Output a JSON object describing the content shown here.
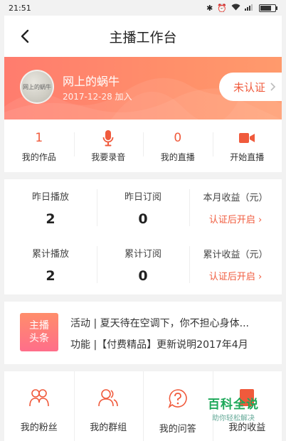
{
  "status_bar": {
    "time": "21:51",
    "icons": [
      "bluetooth-icon",
      "alarm-icon",
      "wifi-icon",
      "signal-icon",
      "battery-icon"
    ]
  },
  "nav": {
    "title": "主播工作台",
    "back_icon": "chevron-left-icon"
  },
  "profile": {
    "name": "网上的蜗牛",
    "joined": "2017-12-28 加入",
    "avatar_text": "网上的蜗牛",
    "verify_label": "未认证"
  },
  "quick_actions": [
    {
      "value": "1",
      "label": "我的作品"
    },
    {
      "icon": "microphone-icon",
      "label": "我要录音"
    },
    {
      "value": "0",
      "label": "我的直播"
    },
    {
      "icon": "video-camera-icon",
      "label": "开始直播"
    }
  ],
  "stats": {
    "row1": [
      {
        "label": "昨日播放",
        "value": "2"
      },
      {
        "label": "昨日订阅",
        "value": "0"
      },
      {
        "label": "本月收益（元）",
        "link": "认证后开启"
      }
    ],
    "row2": [
      {
        "label": "累计播放",
        "value": "2"
      },
      {
        "label": "累计订阅",
        "value": "0"
      },
      {
        "label": "累计收益（元）",
        "link": "认证后开启"
      }
    ]
  },
  "news": {
    "badge_line1": "主播",
    "badge_line2": "头条",
    "items": [
      "活动 | 夏天待在空调下，你不担心身体...",
      "功能 |【付费精品】更新说明2017年4月"
    ]
  },
  "bottom_menu": [
    {
      "label": "我的粉丝",
      "icon": "fans-icon"
    },
    {
      "label": "我的群组",
      "icon": "group-icon"
    },
    {
      "label": "我的问答",
      "icon": "question-icon"
    },
    {
      "label": "我的收益",
      "icon": "income-icon"
    }
  ],
  "watermark": {
    "title": "百科全说",
    "subtitle": "助你轻松解决"
  },
  "colors": {
    "accent": "#f05a3c",
    "banner_start": "#ff7c6e",
    "banner_end": "#ff9a6c",
    "background": "#f2f2f2"
  }
}
